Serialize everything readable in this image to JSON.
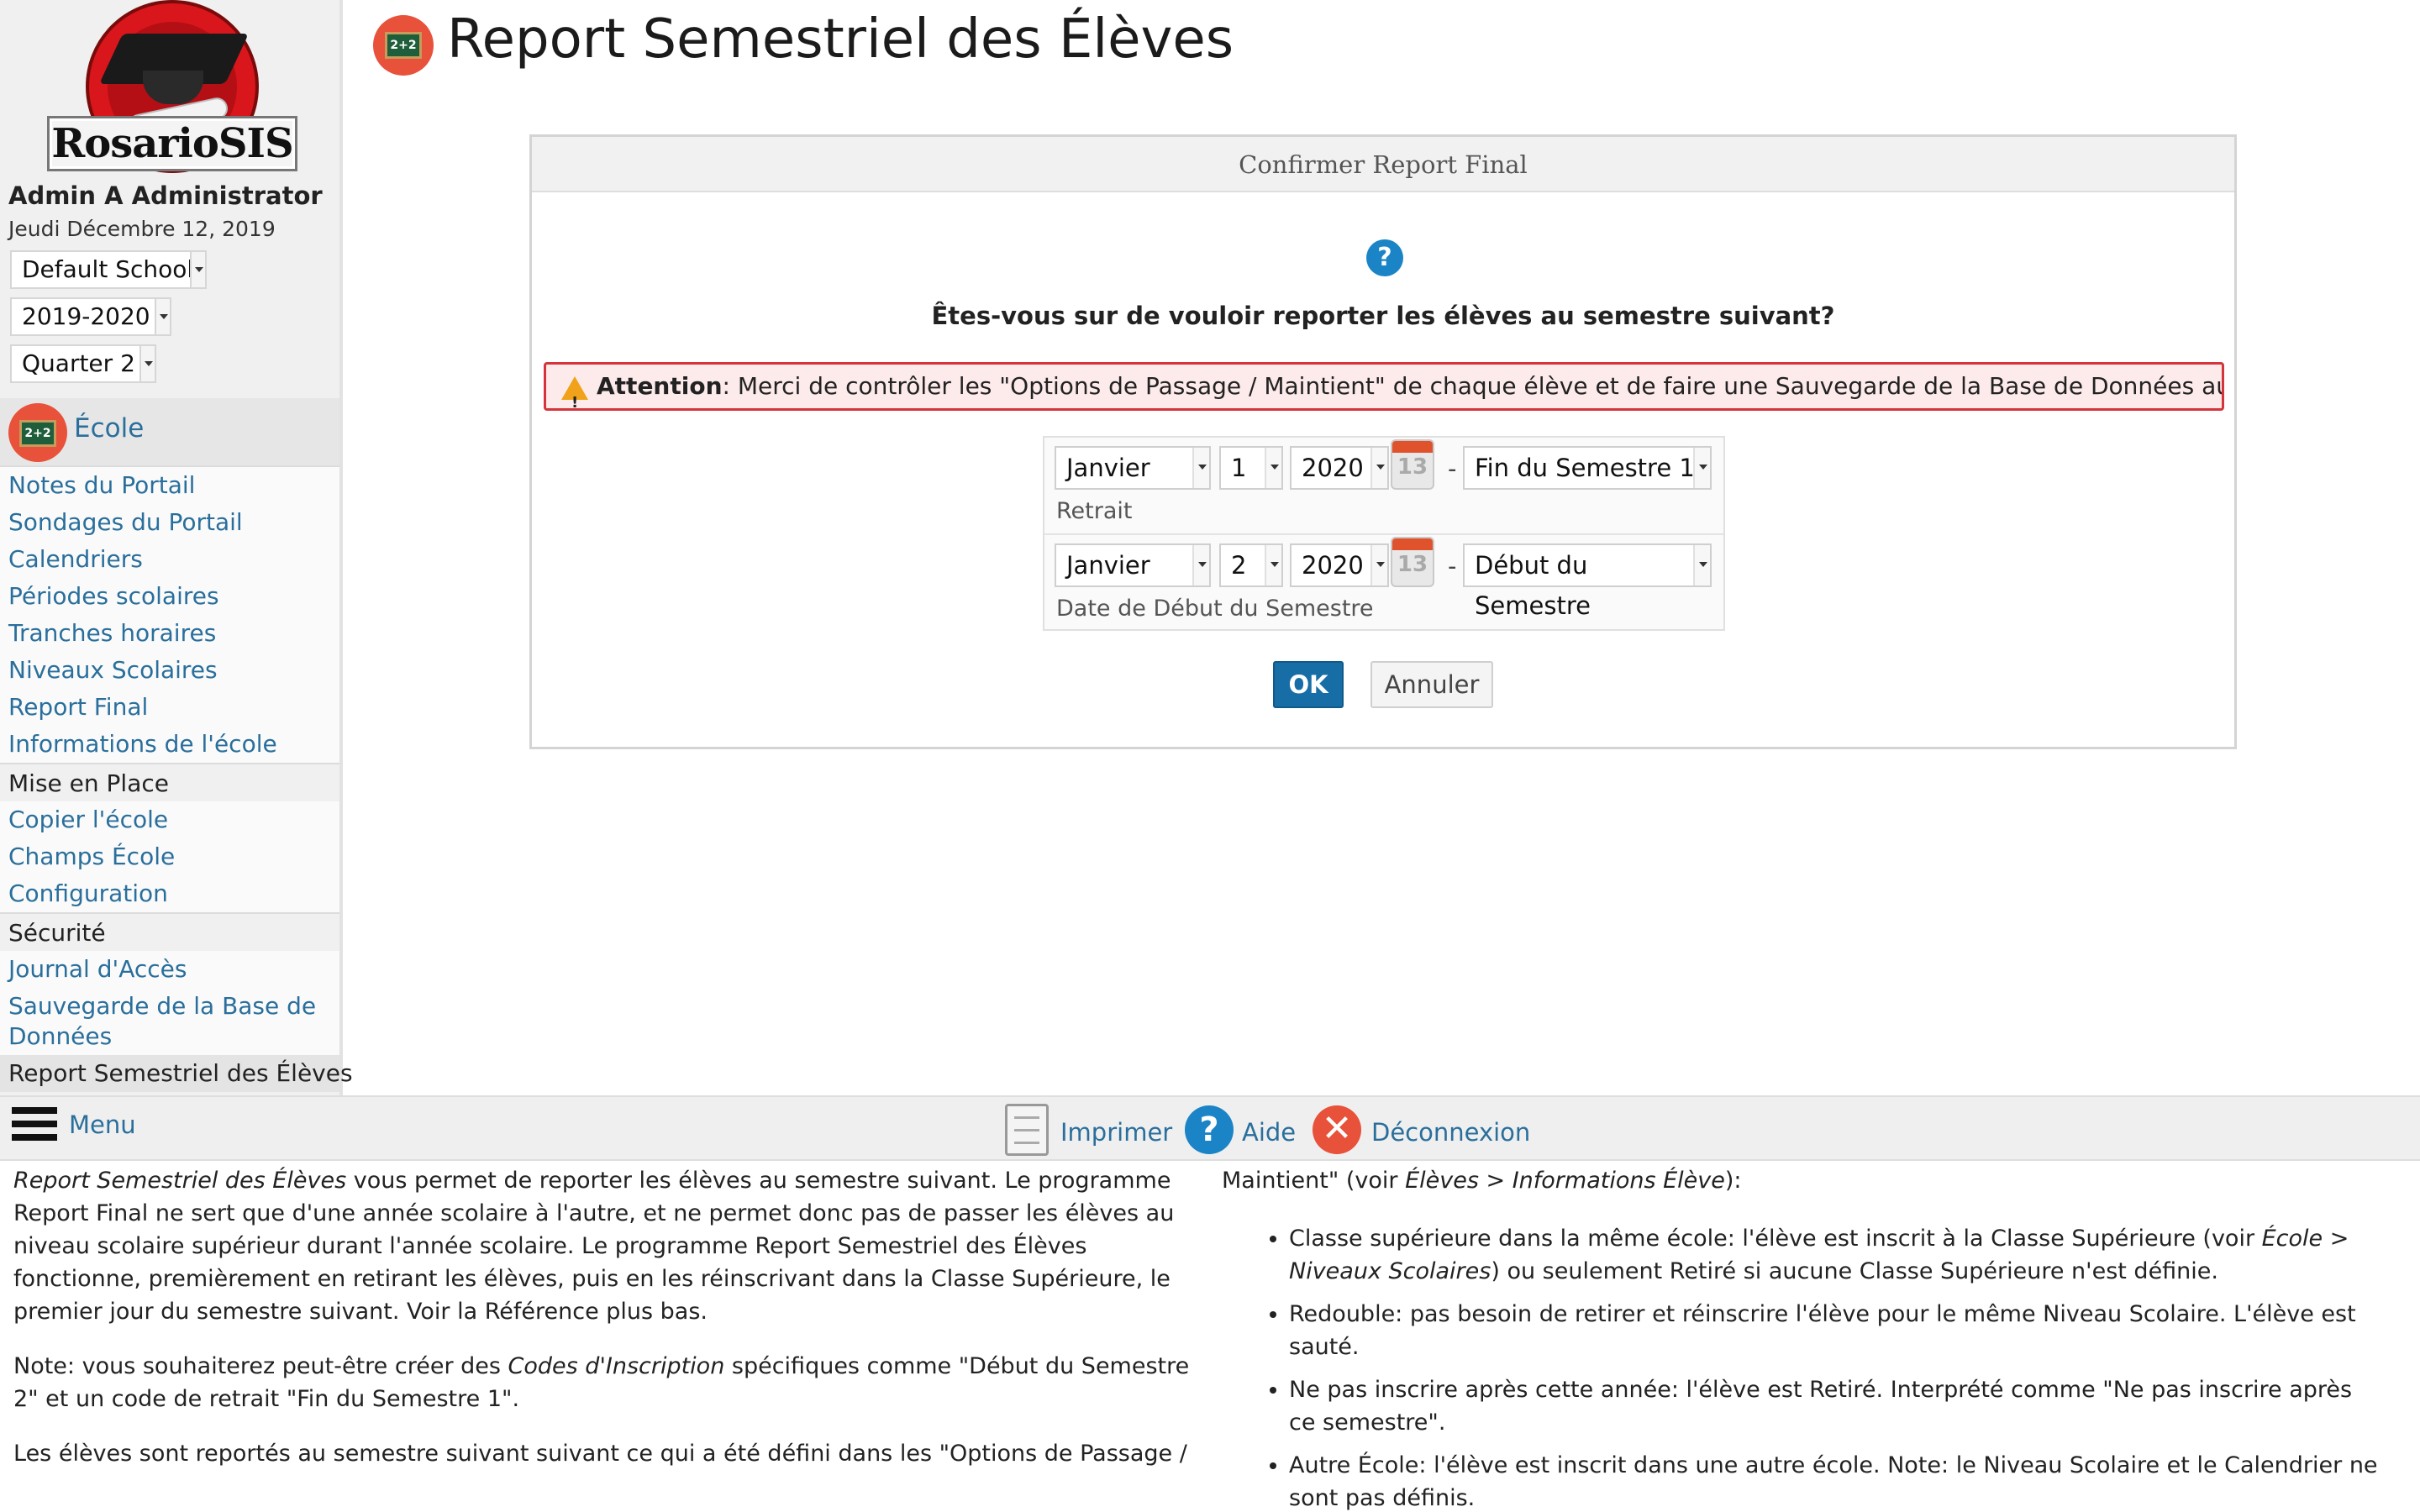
{
  "brand": {
    "logo_text": "RosarioSIS"
  },
  "user": {
    "name": "Admin A Administrator",
    "date": "Jeudi Décembre 12, 2019"
  },
  "selectors": {
    "school": "Default School",
    "year": "2019-2020",
    "period": "Quarter 2"
  },
  "sidebar": {
    "module": "École",
    "group1": [
      "Notes du Portail",
      "Sondages du Portail",
      "Calendriers",
      "Périodes scolaires",
      "Tranches horaires",
      "Niveaux Scolaires",
      "Report Final",
      "Informations de l'école"
    ],
    "head2": "Mise en Place",
    "group2": [
      "Copier l'école",
      "Champs École",
      "Configuration"
    ],
    "head3": "Sécurité",
    "group3": [
      "Journal d'Accès",
      "Sauvegarde de la Base de Données"
    ],
    "current": "Report Semestriel des Élèves"
  },
  "header": {
    "title": "Report Semestriel des Élèves",
    "icon_text": "2+2"
  },
  "dialog": {
    "title": "Confirmer Report Final",
    "question": "Êtes-vous sur de vouloir reporter les élèves au semestre suivant?",
    "warning_strong": "Attention",
    "warning_text": ": Merci de contrôler les \"Options de Passage / Maintient\" de chaque élève et de faire une Sauvegarde de la Base de Données au préalable.",
    "row1": {
      "month": "Janvier",
      "day": "1",
      "year": "2020",
      "calendar": "13",
      "code": "Fin du Semestre 1",
      "label": "Retrait"
    },
    "row2": {
      "month": "Janvier",
      "day": "2",
      "year": "2020",
      "calendar": "13",
      "code": "Début du Semestre",
      "label": "Date de Début du Semestre"
    },
    "ok": "OK",
    "cancel": "Annuler"
  },
  "footer": {
    "menu": "Menu",
    "print": "Imprimer",
    "help": "Aide",
    "logout": "Déconnexion"
  },
  "help": {
    "p1_em": "Report Semestriel des Élèves",
    "p1": " vous permet de reporter les élèves au semestre suivant. Le programme Report Final ne sert que d'une année scolaire à l'autre, et ne permet donc pas de passer les élèves au niveau scolaire supérieur durant l'année scolaire. Le programme Report Semestriel des Élèves fonctionne, premièrement en retirant les élèves, puis en les réinscrivant dans la Classe Supérieure, le premier jour du semestre suivant. Voir la Référence plus bas.",
    "p2_a": "Note: vous souhaiterez peut-être créer des ",
    "p2_em": "Codes d'Inscription",
    "p2_b": " spécifiques comme \"Début du Semestre 2\" et un code de retrait \"Fin du Semestre 1\".",
    "p3": "Les élèves sont reportés au semestre suivant suivant ce qui a été défini dans les \"Options de Passage /",
    "p4_a": "Maintient\" (voir ",
    "p4_em": "Élèves > Informations Élève",
    "p4_b": "):",
    "li1_a": "Classe supérieure dans la même école: l'élève est inscrit à la Classe Supérieure (voir ",
    "li1_em": "École > Niveaux Scolaires",
    "li1_b": ") ou seulement Retiré si aucune Classe Supérieure n'est définie.",
    "li2": "Redouble: pas besoin de retirer et réinscrire l'élève pour le même Niveau Scolaire. L'élève est sauté.",
    "li3": "Ne pas inscrire après cette année: l'élève est Retiré. Interprété comme \"Ne pas inscrire après ce semestre\".",
    "li4": "Autre École: l'élève est inscrit dans une autre école. Note: le Niveau Scolaire et le Calendrier ne sont pas définis."
  }
}
